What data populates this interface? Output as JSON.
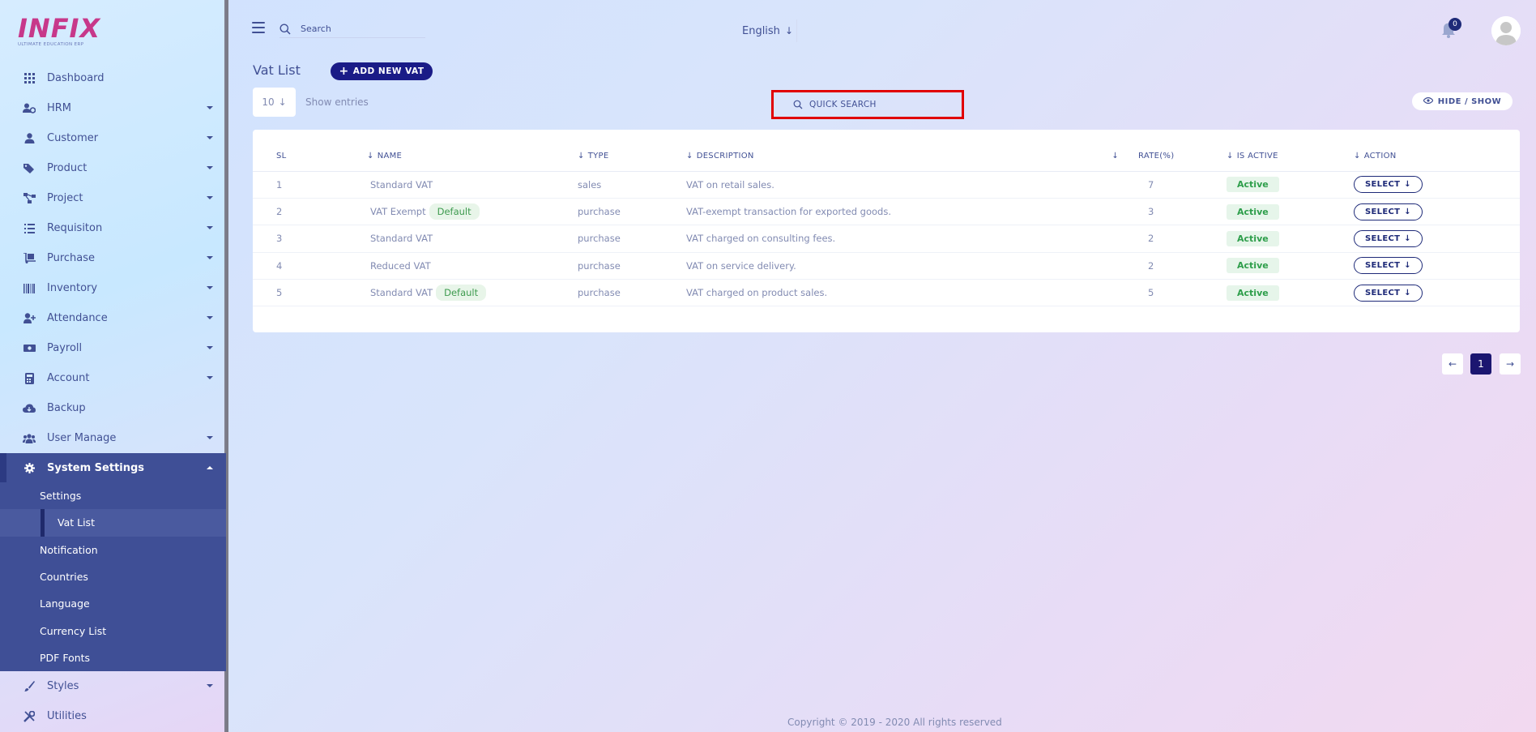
{
  "brand": {
    "logo_text": "INFIX",
    "logo_subtitle": "ULTIMATE EDUCATION ERP"
  },
  "sidebar": {
    "items": [
      {
        "label": "Dashboard",
        "icon": "grid-icon",
        "has_caret": false
      },
      {
        "label": "HRM",
        "icon": "users-cog-icon",
        "has_caret": true
      },
      {
        "label": "Customer",
        "icon": "user-icon",
        "has_caret": true
      },
      {
        "label": "Product",
        "icon": "tags-icon",
        "has_caret": true
      },
      {
        "label": "Project",
        "icon": "project-diagram-icon",
        "has_caret": true
      },
      {
        "label": "Requisiton",
        "icon": "list-icon",
        "has_caret": true
      },
      {
        "label": "Purchase",
        "icon": "dolly-icon",
        "has_caret": true
      },
      {
        "label": "Inventory",
        "icon": "barcode-icon",
        "has_caret": true
      },
      {
        "label": "Attendance",
        "icon": "user-plus-icon",
        "has_caret": true
      },
      {
        "label": "Payroll",
        "icon": "money-icon",
        "has_caret": true
      },
      {
        "label": "Account",
        "icon": "calculator-icon",
        "has_caret": true
      },
      {
        "label": "Backup",
        "icon": "cloud-download-icon",
        "has_caret": false
      },
      {
        "label": "User Manage",
        "icon": "users-icon",
        "has_caret": true
      }
    ],
    "active_group": {
      "label": "System Settings",
      "icon": "gear-icon",
      "sub_items": [
        {
          "label": "Settings",
          "active": false
        },
        {
          "label": "Vat List",
          "active": true
        },
        {
          "label": "Notification",
          "active": false
        },
        {
          "label": "Countries",
          "active": false
        },
        {
          "label": "Language",
          "active": false
        },
        {
          "label": "Currency List",
          "active": false
        },
        {
          "label": "PDF Fonts",
          "active": false
        }
      ]
    },
    "bottom_items": [
      {
        "label": "Styles",
        "icon": "brush-icon",
        "has_caret": true
      },
      {
        "label": "Utilities",
        "icon": "tools-icon",
        "has_caret": false
      }
    ]
  },
  "topbar": {
    "search_placeholder": "Search",
    "language": "English",
    "notification_count": "0"
  },
  "page": {
    "title": "Vat List",
    "add_button": "ADD NEW VAT",
    "entries_value": "10",
    "entries_label": "Show entries",
    "quick_search_placeholder": "QUICK SEARCH",
    "hide_show_label": "HIDE / SHOW"
  },
  "table": {
    "columns": [
      "SL",
      "NAME",
      "TYPE",
      "DESCRIPTION",
      "",
      "RATE(%)",
      "IS ACTIVE",
      "ACTION"
    ],
    "rows": [
      {
        "sl": "1",
        "name": "Standard VAT",
        "default": "",
        "type": "sales",
        "description": "VAT on retail sales.",
        "rate": "7",
        "status": "Active",
        "action": "SELECT"
      },
      {
        "sl": "2",
        "name": "VAT Exempt",
        "default": "Default",
        "type": "purchase",
        "description": "VAT-exempt transaction for exported goods.",
        "rate": "3",
        "status": "Active",
        "action": "SELECT"
      },
      {
        "sl": "3",
        "name": "Standard VAT",
        "default": "",
        "type": "purchase",
        "description": "VAT charged on consulting fees.",
        "rate": "2",
        "status": "Active",
        "action": "SELECT"
      },
      {
        "sl": "4",
        "name": "Reduced VAT",
        "default": "",
        "type": "purchase",
        "description": "VAT on service delivery.",
        "rate": "2",
        "status": "Active",
        "action": "SELECT"
      },
      {
        "sl": "5",
        "name": "Standard VAT",
        "default": "Default",
        "type": "purchase",
        "description": "VAT charged on product sales.",
        "rate": "5",
        "status": "Active",
        "action": "SELECT"
      }
    ]
  },
  "pagination": {
    "prev": "←",
    "current": "1",
    "next": "→"
  },
  "footer": {
    "text": "Copyright © 2019 - 2020 All rights reserved"
  },
  "colors": {
    "primary": "#415094",
    "accent": "#1a1b87",
    "highlight_box": "#e10000",
    "active_green": "#2e9e4b"
  }
}
